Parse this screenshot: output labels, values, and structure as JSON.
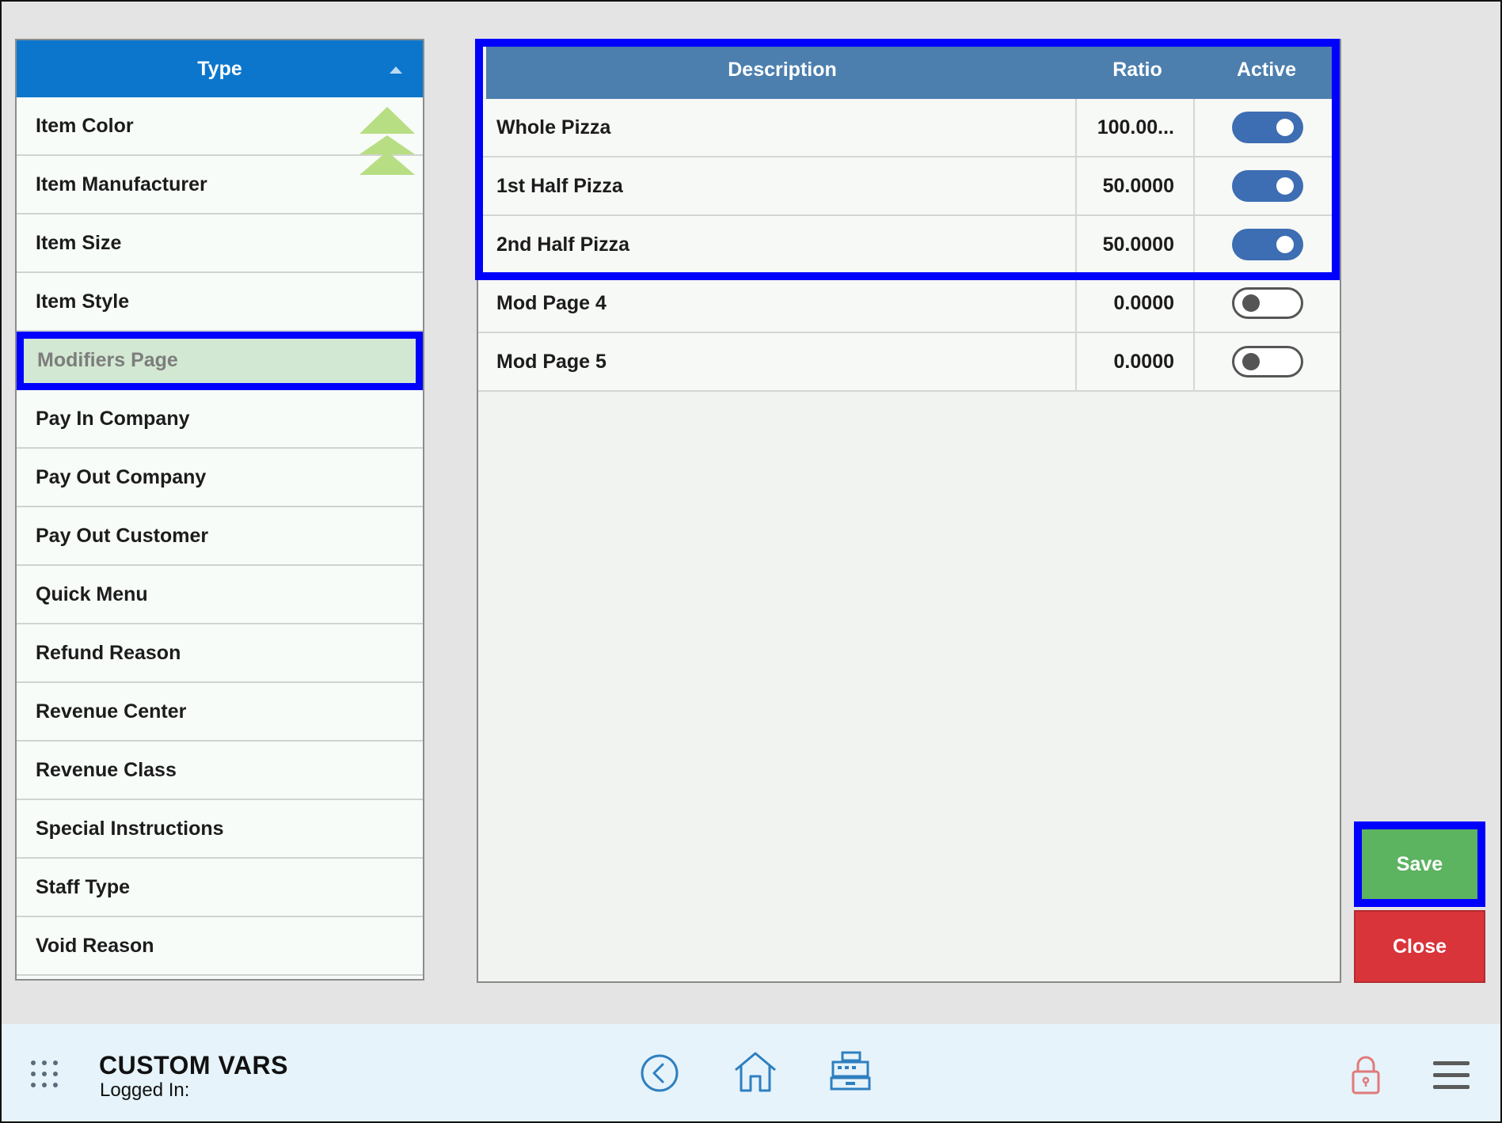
{
  "type_list": {
    "header": "Type",
    "items": [
      {
        "label": "Item Color"
      },
      {
        "label": "Item Manufacturer"
      },
      {
        "label": "Item Size"
      },
      {
        "label": "Item Style"
      },
      {
        "label": "Modifiers Page",
        "selected": true
      },
      {
        "label": "Pay In Company"
      },
      {
        "label": "Pay Out Company"
      },
      {
        "label": "Pay Out Customer"
      },
      {
        "label": "Quick Menu"
      },
      {
        "label": "Refund Reason"
      },
      {
        "label": "Revenue Center"
      },
      {
        "label": "Revenue Class"
      },
      {
        "label": "Special Instructions"
      },
      {
        "label": "Staff Type"
      },
      {
        "label": "Void Reason"
      }
    ]
  },
  "grid": {
    "columns": {
      "description": "Description",
      "ratio": "Ratio",
      "active": "Active"
    },
    "rows": [
      {
        "description": "Whole Pizza",
        "ratio": "100.00...",
        "active": true
      },
      {
        "description": "1st Half Pizza",
        "ratio": "50.0000",
        "active": true
      },
      {
        "description": "2nd Half Pizza",
        "ratio": "50.0000",
        "active": true
      },
      {
        "description": "Mod Page 4",
        "ratio": "0.0000",
        "active": false
      },
      {
        "description": "Mod Page 5",
        "ratio": "0.0000",
        "active": false
      }
    ]
  },
  "buttons": {
    "save": "Save",
    "close": "Close"
  },
  "footer": {
    "title": "CUSTOM VARS",
    "logged_in": "Logged In:"
  },
  "colors": {
    "header_blue": "#0b76cc",
    "grid_header": "#4c7fae",
    "save_green": "#5cb360",
    "close_red": "#d9343a",
    "highlight": "#0000ff"
  }
}
